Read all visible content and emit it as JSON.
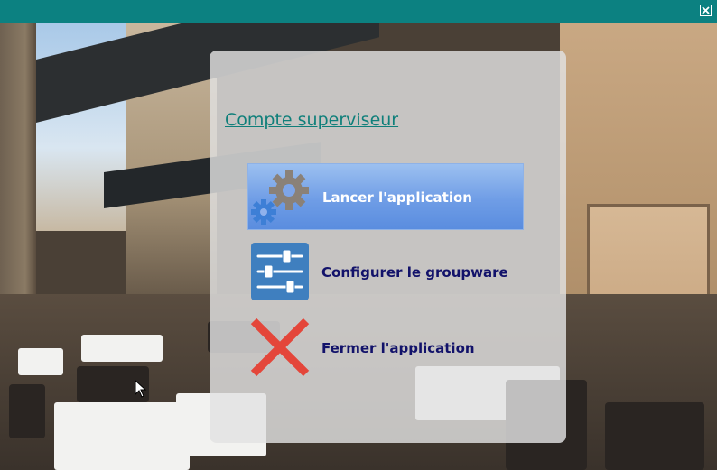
{
  "window": {
    "close_icon": "close-icon",
    "titlebar_color": "#0c8181"
  },
  "panel": {
    "title": "Compte superviseur",
    "title_color": "#0f7f7a"
  },
  "actions": [
    {
      "label": "Lancer l'application",
      "icon": "gears-icon",
      "selected": true
    },
    {
      "label": "Configurer le groupware",
      "icon": "sliders-icon",
      "selected": false
    },
    {
      "label": "Fermer l'application",
      "icon": "red-x-icon",
      "selected": false
    }
  ]
}
